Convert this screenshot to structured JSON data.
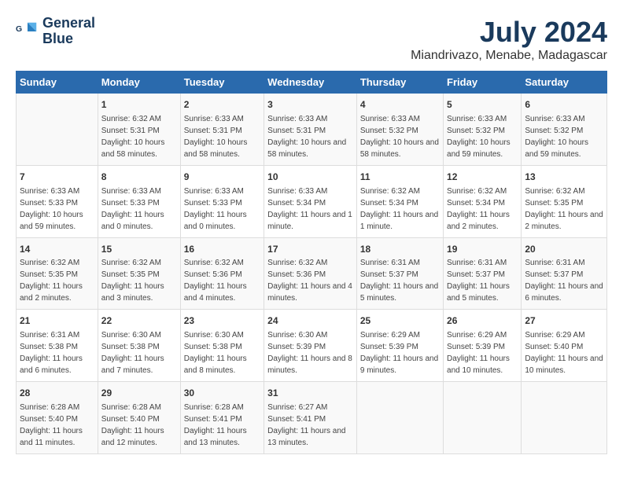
{
  "header": {
    "logo_line1": "General",
    "logo_line2": "Blue",
    "title": "July 2024",
    "subtitle": "Miandrivazo, Menabe, Madagascar"
  },
  "weekdays": [
    "Sunday",
    "Monday",
    "Tuesday",
    "Wednesday",
    "Thursday",
    "Friday",
    "Saturday"
  ],
  "weeks": [
    [
      {
        "day": "",
        "sunrise": "",
        "sunset": "",
        "daylight": ""
      },
      {
        "day": "1",
        "sunrise": "Sunrise: 6:32 AM",
        "sunset": "Sunset: 5:31 PM",
        "daylight": "Daylight: 10 hours and 58 minutes."
      },
      {
        "day": "2",
        "sunrise": "Sunrise: 6:33 AM",
        "sunset": "Sunset: 5:31 PM",
        "daylight": "Daylight: 10 hours and 58 minutes."
      },
      {
        "day": "3",
        "sunrise": "Sunrise: 6:33 AM",
        "sunset": "Sunset: 5:31 PM",
        "daylight": "Daylight: 10 hours and 58 minutes."
      },
      {
        "day": "4",
        "sunrise": "Sunrise: 6:33 AM",
        "sunset": "Sunset: 5:32 PM",
        "daylight": "Daylight: 10 hours and 58 minutes."
      },
      {
        "day": "5",
        "sunrise": "Sunrise: 6:33 AM",
        "sunset": "Sunset: 5:32 PM",
        "daylight": "Daylight: 10 hours and 59 minutes."
      },
      {
        "day": "6",
        "sunrise": "Sunrise: 6:33 AM",
        "sunset": "Sunset: 5:32 PM",
        "daylight": "Daylight: 10 hours and 59 minutes."
      }
    ],
    [
      {
        "day": "7",
        "sunrise": "Sunrise: 6:33 AM",
        "sunset": "Sunset: 5:33 PM",
        "daylight": "Daylight: 10 hours and 59 minutes."
      },
      {
        "day": "8",
        "sunrise": "Sunrise: 6:33 AM",
        "sunset": "Sunset: 5:33 PM",
        "daylight": "Daylight: 11 hours and 0 minutes."
      },
      {
        "day": "9",
        "sunrise": "Sunrise: 6:33 AM",
        "sunset": "Sunset: 5:33 PM",
        "daylight": "Daylight: 11 hours and 0 minutes."
      },
      {
        "day": "10",
        "sunrise": "Sunrise: 6:33 AM",
        "sunset": "Sunset: 5:34 PM",
        "daylight": "Daylight: 11 hours and 1 minute."
      },
      {
        "day": "11",
        "sunrise": "Sunrise: 6:32 AM",
        "sunset": "Sunset: 5:34 PM",
        "daylight": "Daylight: 11 hours and 1 minute."
      },
      {
        "day": "12",
        "sunrise": "Sunrise: 6:32 AM",
        "sunset": "Sunset: 5:34 PM",
        "daylight": "Daylight: 11 hours and 2 minutes."
      },
      {
        "day": "13",
        "sunrise": "Sunrise: 6:32 AM",
        "sunset": "Sunset: 5:35 PM",
        "daylight": "Daylight: 11 hours and 2 minutes."
      }
    ],
    [
      {
        "day": "14",
        "sunrise": "Sunrise: 6:32 AM",
        "sunset": "Sunset: 5:35 PM",
        "daylight": "Daylight: 11 hours and 2 minutes."
      },
      {
        "day": "15",
        "sunrise": "Sunrise: 6:32 AM",
        "sunset": "Sunset: 5:35 PM",
        "daylight": "Daylight: 11 hours and 3 minutes."
      },
      {
        "day": "16",
        "sunrise": "Sunrise: 6:32 AM",
        "sunset": "Sunset: 5:36 PM",
        "daylight": "Daylight: 11 hours and 4 minutes."
      },
      {
        "day": "17",
        "sunrise": "Sunrise: 6:32 AM",
        "sunset": "Sunset: 5:36 PM",
        "daylight": "Daylight: 11 hours and 4 minutes."
      },
      {
        "day": "18",
        "sunrise": "Sunrise: 6:31 AM",
        "sunset": "Sunset: 5:37 PM",
        "daylight": "Daylight: 11 hours and 5 minutes."
      },
      {
        "day": "19",
        "sunrise": "Sunrise: 6:31 AM",
        "sunset": "Sunset: 5:37 PM",
        "daylight": "Daylight: 11 hours and 5 minutes."
      },
      {
        "day": "20",
        "sunrise": "Sunrise: 6:31 AM",
        "sunset": "Sunset: 5:37 PM",
        "daylight": "Daylight: 11 hours and 6 minutes."
      }
    ],
    [
      {
        "day": "21",
        "sunrise": "Sunrise: 6:31 AM",
        "sunset": "Sunset: 5:38 PM",
        "daylight": "Daylight: 11 hours and 6 minutes."
      },
      {
        "day": "22",
        "sunrise": "Sunrise: 6:30 AM",
        "sunset": "Sunset: 5:38 PM",
        "daylight": "Daylight: 11 hours and 7 minutes."
      },
      {
        "day": "23",
        "sunrise": "Sunrise: 6:30 AM",
        "sunset": "Sunset: 5:38 PM",
        "daylight": "Daylight: 11 hours and 8 minutes."
      },
      {
        "day": "24",
        "sunrise": "Sunrise: 6:30 AM",
        "sunset": "Sunset: 5:39 PM",
        "daylight": "Daylight: 11 hours and 8 minutes."
      },
      {
        "day": "25",
        "sunrise": "Sunrise: 6:29 AM",
        "sunset": "Sunset: 5:39 PM",
        "daylight": "Daylight: 11 hours and 9 minutes."
      },
      {
        "day": "26",
        "sunrise": "Sunrise: 6:29 AM",
        "sunset": "Sunset: 5:39 PM",
        "daylight": "Daylight: 11 hours and 10 minutes."
      },
      {
        "day": "27",
        "sunrise": "Sunrise: 6:29 AM",
        "sunset": "Sunset: 5:40 PM",
        "daylight": "Daylight: 11 hours and 10 minutes."
      }
    ],
    [
      {
        "day": "28",
        "sunrise": "Sunrise: 6:28 AM",
        "sunset": "Sunset: 5:40 PM",
        "daylight": "Daylight: 11 hours and 11 minutes."
      },
      {
        "day": "29",
        "sunrise": "Sunrise: 6:28 AM",
        "sunset": "Sunset: 5:40 PM",
        "daylight": "Daylight: 11 hours and 12 minutes."
      },
      {
        "day": "30",
        "sunrise": "Sunrise: 6:28 AM",
        "sunset": "Sunset: 5:41 PM",
        "daylight": "Daylight: 11 hours and 13 minutes."
      },
      {
        "day": "31",
        "sunrise": "Sunrise: 6:27 AM",
        "sunset": "Sunset: 5:41 PM",
        "daylight": "Daylight: 11 hours and 13 minutes."
      },
      {
        "day": "",
        "sunrise": "",
        "sunset": "",
        "daylight": ""
      },
      {
        "day": "",
        "sunrise": "",
        "sunset": "",
        "daylight": ""
      },
      {
        "day": "",
        "sunrise": "",
        "sunset": "",
        "daylight": ""
      }
    ]
  ]
}
